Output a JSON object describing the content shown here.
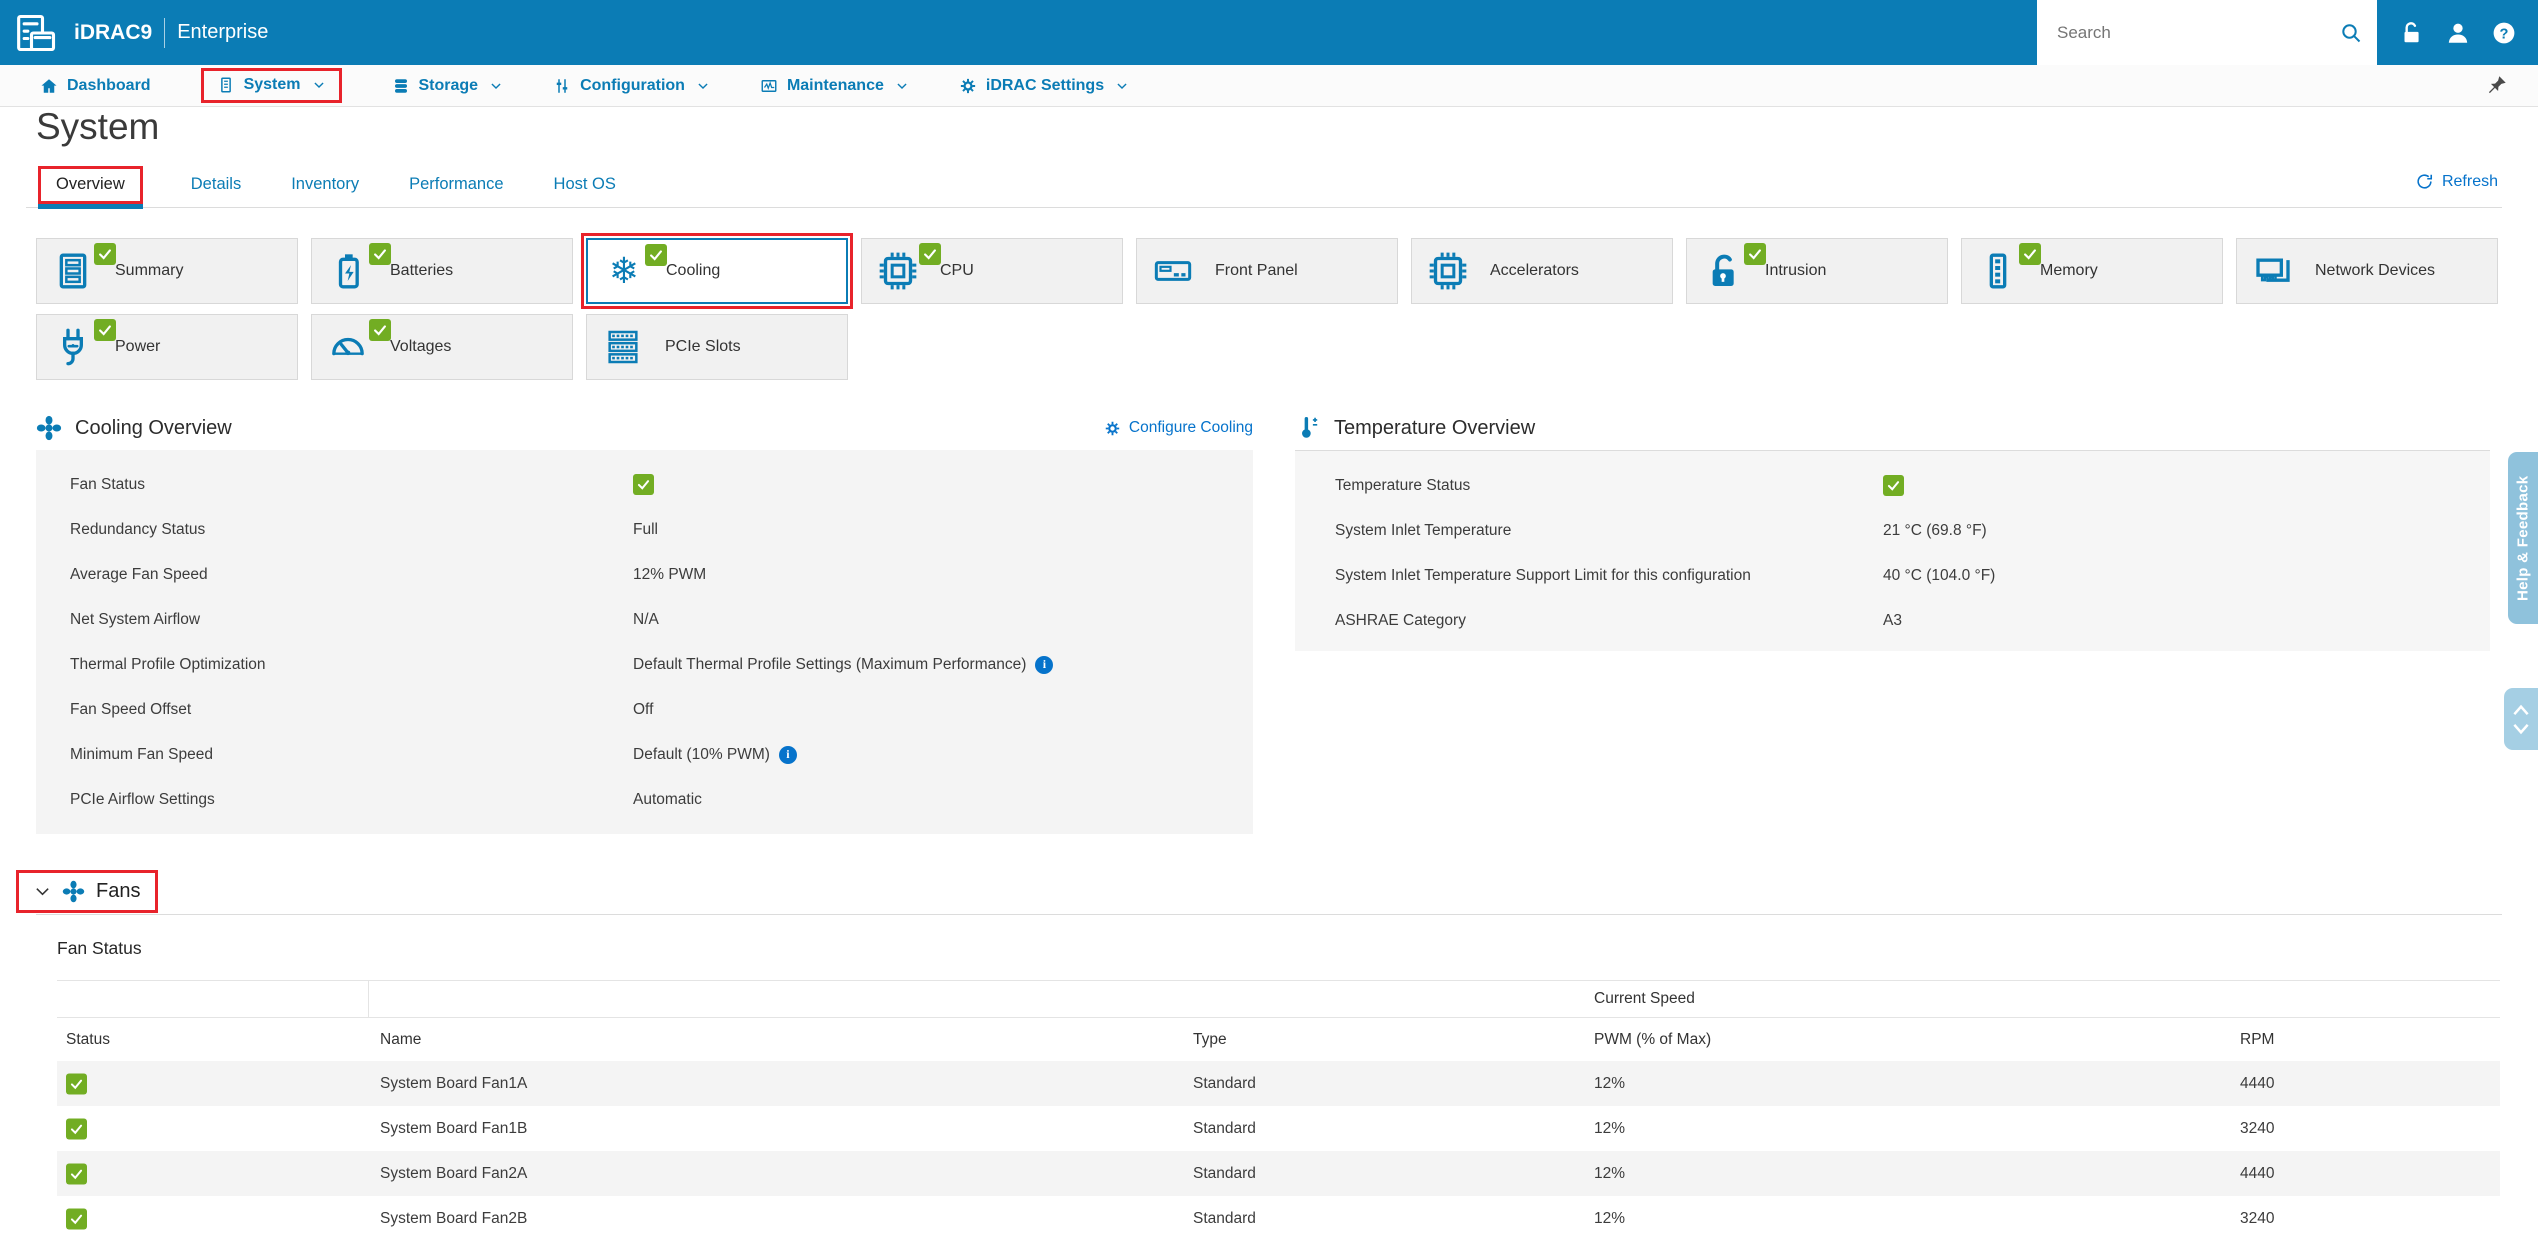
{
  "header": {
    "product": "iDRAC9",
    "edition": "Enterprise",
    "search_placeholder": "Search",
    "icons": [
      "search-icon",
      "unlock-icon",
      "user-icon",
      "help-icon"
    ]
  },
  "nav": {
    "items": [
      {
        "label": "Dashboard",
        "icon": "home-icon",
        "dropdown": false,
        "highlighted": false
      },
      {
        "label": "System",
        "icon": "server-icon",
        "dropdown": true,
        "highlighted": true
      },
      {
        "label": "Storage",
        "icon": "storage-icon",
        "dropdown": true,
        "highlighted": false
      },
      {
        "label": "Configuration",
        "icon": "sliders-icon",
        "dropdown": true,
        "highlighted": false
      },
      {
        "label": "Maintenance",
        "icon": "maintenance-icon",
        "dropdown": true,
        "highlighted": false
      },
      {
        "label": "iDRAC Settings",
        "icon": "gear-icon",
        "dropdown": true,
        "highlighted": false
      }
    ],
    "pin_icon": "pushpin-icon"
  },
  "page": {
    "title": "System",
    "tabs": [
      {
        "label": "Overview",
        "active": true,
        "highlighted": true
      },
      {
        "label": "Details",
        "active": false
      },
      {
        "label": "Inventory",
        "active": false
      },
      {
        "label": "Performance",
        "active": false
      },
      {
        "label": "Host OS",
        "active": false
      }
    ],
    "refresh_label": "Refresh"
  },
  "tiles": {
    "row1": [
      {
        "label": "Summary",
        "icon": "summary-server-icon",
        "ok": true
      },
      {
        "label": "Batteries",
        "icon": "battery-icon",
        "ok": true
      },
      {
        "label": "Cooling",
        "icon": "snowflake-icon",
        "ok": true,
        "selected": true,
        "highlighted": true
      },
      {
        "label": "CPU",
        "icon": "cpu-chip-icon",
        "ok": true
      },
      {
        "label": "Front Panel",
        "icon": "front-panel-icon",
        "ok": false
      },
      {
        "label": "Accelerators",
        "icon": "accelerator-chip-icon",
        "ok": false
      },
      {
        "label": "Intrusion",
        "icon": "padlock-icon",
        "ok": true
      },
      {
        "label": "Memory",
        "icon": "memory-dimm-icon",
        "ok": true
      },
      {
        "label": "Network Devices",
        "icon": "network-card-icon",
        "ok": false
      }
    ],
    "row2": [
      {
        "label": "Power",
        "icon": "power-plug-icon",
        "ok": true
      },
      {
        "label": "Voltages",
        "icon": "gauge-icon",
        "ok": true
      },
      {
        "label": "PCIe Slots",
        "icon": "pcie-slots-icon",
        "ok": false
      }
    ]
  },
  "cooling_overview": {
    "title": "Cooling Overview",
    "icon": "fan-icon",
    "action": "Configure Cooling",
    "action_icon": "gears-icon",
    "rows": [
      {
        "label": "Fan Status",
        "value": "",
        "status_ok": true
      },
      {
        "label": "Redundancy Status",
        "value": "Full"
      },
      {
        "label": "Average Fan Speed",
        "value": "12% PWM"
      },
      {
        "label": "Net System Airflow",
        "value": "N/A"
      },
      {
        "label": "Thermal Profile Optimization",
        "value": "Default Thermal Profile Settings (Maximum Performance)",
        "info": true
      },
      {
        "label": "Fan Speed Offset",
        "value": "Off"
      },
      {
        "label": "Minimum Fan Speed",
        "value": "Default (10% PWM)",
        "info": true
      },
      {
        "label": "PCIe Airflow Settings",
        "value": "Automatic"
      }
    ]
  },
  "temperature_overview": {
    "title": "Temperature Overview",
    "icon": "thermometer-icon",
    "rows": [
      {
        "label": "Temperature Status",
        "value": "",
        "status_ok": true
      },
      {
        "label": "System Inlet Temperature",
        "value": "21 °C (69.8 °F)"
      },
      {
        "label": "System Inlet Temperature Support Limit for this configuration",
        "value": "40 °C (104.0 °F)"
      },
      {
        "label": "ASHRAE Category",
        "value": "A3"
      }
    ]
  },
  "fans_section": {
    "title": "Fans",
    "icon": "fan-icon",
    "collapse_icon": "chevron-down-icon",
    "highlighted": true,
    "table_title": "Fan Status",
    "group_header": "Current Speed",
    "columns": [
      "Status",
      "Name",
      "Type",
      "PWM (% of Max)",
      "RPM"
    ],
    "rows": [
      {
        "status_ok": true,
        "name": "System Board Fan1A",
        "type": "Standard",
        "pwm": "12%",
        "rpm": "4440"
      },
      {
        "status_ok": true,
        "name": "System Board Fan1B",
        "type": "Standard",
        "pwm": "12%",
        "rpm": "3240"
      },
      {
        "status_ok": true,
        "name": "System Board Fan2A",
        "type": "Standard",
        "pwm": "12%",
        "rpm": "4440"
      },
      {
        "status_ok": true,
        "name": "System Board Fan2B",
        "type": "Standard",
        "pwm": "12%",
        "rpm": "3240"
      }
    ]
  },
  "side": {
    "help_feedback_label": "Help & Feedback",
    "scroll_icons": [
      "chevron-up-icon",
      "chevron-down-icon"
    ]
  },
  "colors": {
    "header_blue": "#0B7CB5",
    "link_blue": "#0673CB",
    "ok_green": "#72AD23",
    "highlight_red": "#E8232B",
    "panel_gray": "#F4F4F4",
    "help_tab_blue": "#8FC2DC"
  }
}
